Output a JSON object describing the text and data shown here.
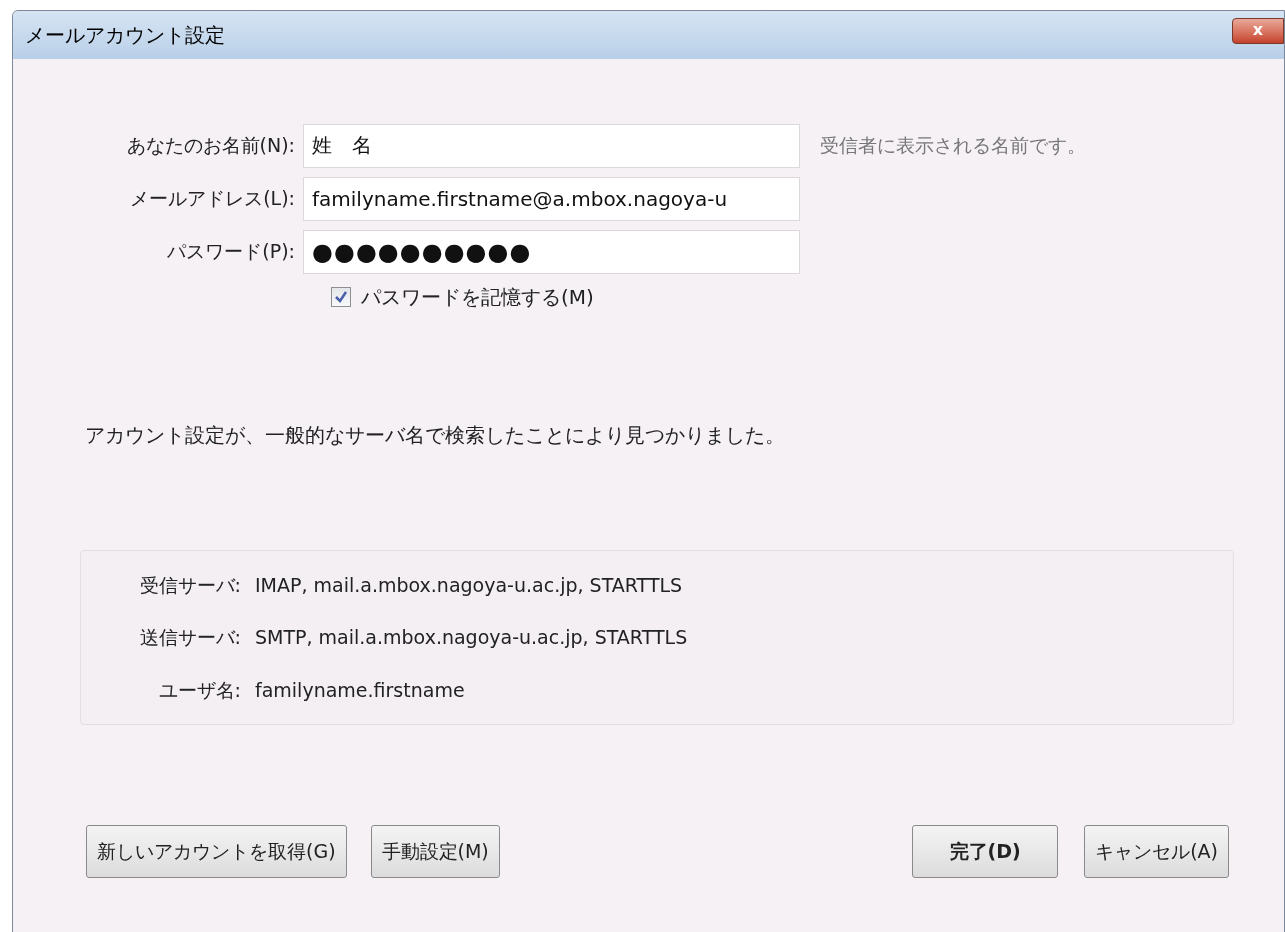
{
  "window": {
    "title": "メールアカウント設定",
    "close": "x"
  },
  "fields": [
    {
      "label": "あなたのお名前(N):",
      "value": "姓　名",
      "hint": "受信者に表示される名前です。"
    },
    {
      "label": "メールアドレス(L):",
      "value": "familyname.firstname@a.mbox.nagoya-u"
    },
    {
      "label": "パスワード(P):",
      "value": "●●●●●●●●●●"
    }
  ],
  "remember_password": {
    "label": "パスワードを記憶する(M)",
    "checked": true
  },
  "message": "アカウント設定が、一般的なサーバ名で検索したことにより見つかりました。",
  "server_info": [
    {
      "label": "受信サーバ:",
      "value": "IMAP, mail.a.mbox.nagoya-u.ac.jp, STARTTLS"
    },
    {
      "label": "送信サーバ:",
      "value": "SMTP, mail.a.mbox.nagoya-u.ac.jp, STARTTLS"
    },
    {
      "label": "ユーザ名:",
      "value": "familyname.firstname"
    }
  ],
  "buttons_left": [
    "新しいアカウントを取得(G)",
    "手動設定(M)"
  ],
  "buttons_right": [
    {
      "label": "完了(D)",
      "default": true
    },
    {
      "label": "キャンセル(A)",
      "default": false
    }
  ]
}
